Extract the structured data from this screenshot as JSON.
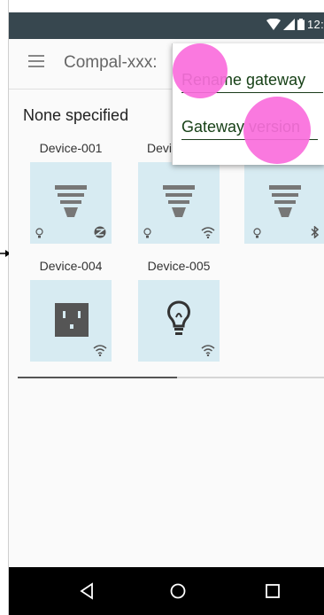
{
  "status_bar": {
    "time": "12:",
    "icons": [
      "wifi-icon",
      "signal-icon",
      "battery-icon"
    ]
  },
  "app_bar": {
    "title": "Compal-xxx:",
    "menu_icon": "hamburger-menu-icon"
  },
  "section": {
    "title": "None specified"
  },
  "devices": [
    {
      "label": "Device-001",
      "type": "bulb-lamp",
      "status_icon": "bulb-small-icon",
      "connectivity": "zigbee-icon"
    },
    {
      "label": "Devi",
      "type": "bulb-lamp",
      "status_icon": "bulb-small-icon",
      "connectivity": "wifi-icon"
    },
    {
      "label": "",
      "type": "bulb-lamp",
      "status_icon": "bulb-small-icon",
      "connectivity": "bluetooth-icon"
    },
    {
      "label": "Device-004",
      "type": "outlet",
      "connectivity": "wifi-icon"
    },
    {
      "label": "Device-005",
      "type": "light-bulb",
      "connectivity": "wifi-icon"
    }
  ],
  "menu": {
    "items": [
      {
        "label": "Rename gateway"
      },
      {
        "label": "Gateway version"
      }
    ]
  },
  "colors": {
    "statusbar": "#37474f",
    "tile": "#d7ebf2",
    "touch": "#fa6edc",
    "menu_text": "#174117"
  },
  "nav_bar": {
    "buttons": [
      "back-icon",
      "home-icon",
      "recents-icon"
    ]
  }
}
